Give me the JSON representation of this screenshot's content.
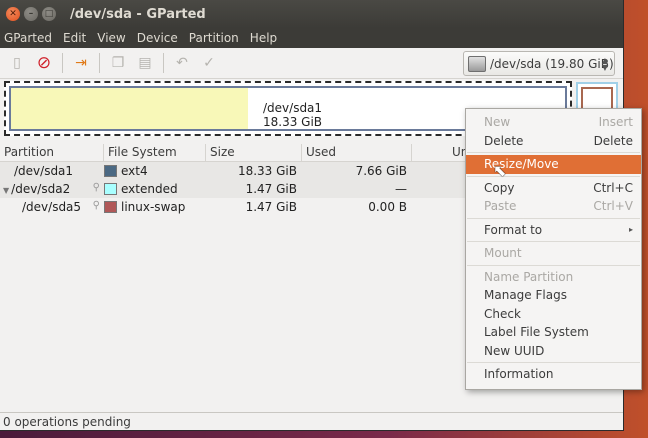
{
  "window": {
    "title": "/dev/sda - GParted"
  },
  "menubar": [
    "GParted",
    "Edit",
    "View",
    "Device",
    "Partition",
    "Help"
  ],
  "toolbar": {
    "device_selector": "/dev/sda  (19.80 GiB)"
  },
  "diskmap": {
    "partition": "/dev/sda1",
    "size": "18.33 GiB"
  },
  "table": {
    "headers": [
      "Partition",
      "File System",
      "Size",
      "Used",
      "Un"
    ],
    "rows": [
      {
        "partition": "/dev/sda1",
        "fs": "ext4",
        "fs_color": "#4b6983",
        "size": "18.33 GiB",
        "used": "7.66 GiB"
      },
      {
        "partition": "/dev/sda2",
        "fs": "extended",
        "fs_color": "#a9ffff",
        "size": "1.47 GiB",
        "used": "—"
      },
      {
        "partition": "/dev/sda5",
        "fs": "linux-swap",
        "fs_color": "#b05858",
        "size": "1.47 GiB",
        "used": "0.00 B"
      }
    ]
  },
  "context_menu": {
    "items": [
      {
        "label": "New",
        "accel": "Insert",
        "disabled": true
      },
      {
        "label": "Delete",
        "accel": "Delete",
        "disabled": false
      },
      {
        "label": "Resize/Move",
        "accel": "",
        "disabled": false,
        "highlight": true
      },
      {
        "label": "Copy",
        "accel": "Ctrl+C",
        "disabled": false
      },
      {
        "label": "Paste",
        "accel": "Ctrl+V",
        "disabled": true
      },
      {
        "label": "Format to",
        "accel": "",
        "disabled": false
      },
      {
        "label": "Mount",
        "accel": "",
        "disabled": true
      },
      {
        "label": "Name Partition",
        "accel": "",
        "disabled": true
      },
      {
        "label": "Manage Flags",
        "accel": "",
        "disabled": false
      },
      {
        "label": "Check",
        "accel": "",
        "disabled": false
      },
      {
        "label": "Label File System",
        "accel": "",
        "disabled": false
      },
      {
        "label": "New UUID",
        "accel": "",
        "disabled": false
      },
      {
        "label": "Information",
        "accel": "",
        "disabled": false
      }
    ]
  },
  "statusbar": {
    "text": "0 operations pending"
  },
  "colors": {
    "highlight": "#e06f35",
    "titlebar": "#3c3b37"
  }
}
